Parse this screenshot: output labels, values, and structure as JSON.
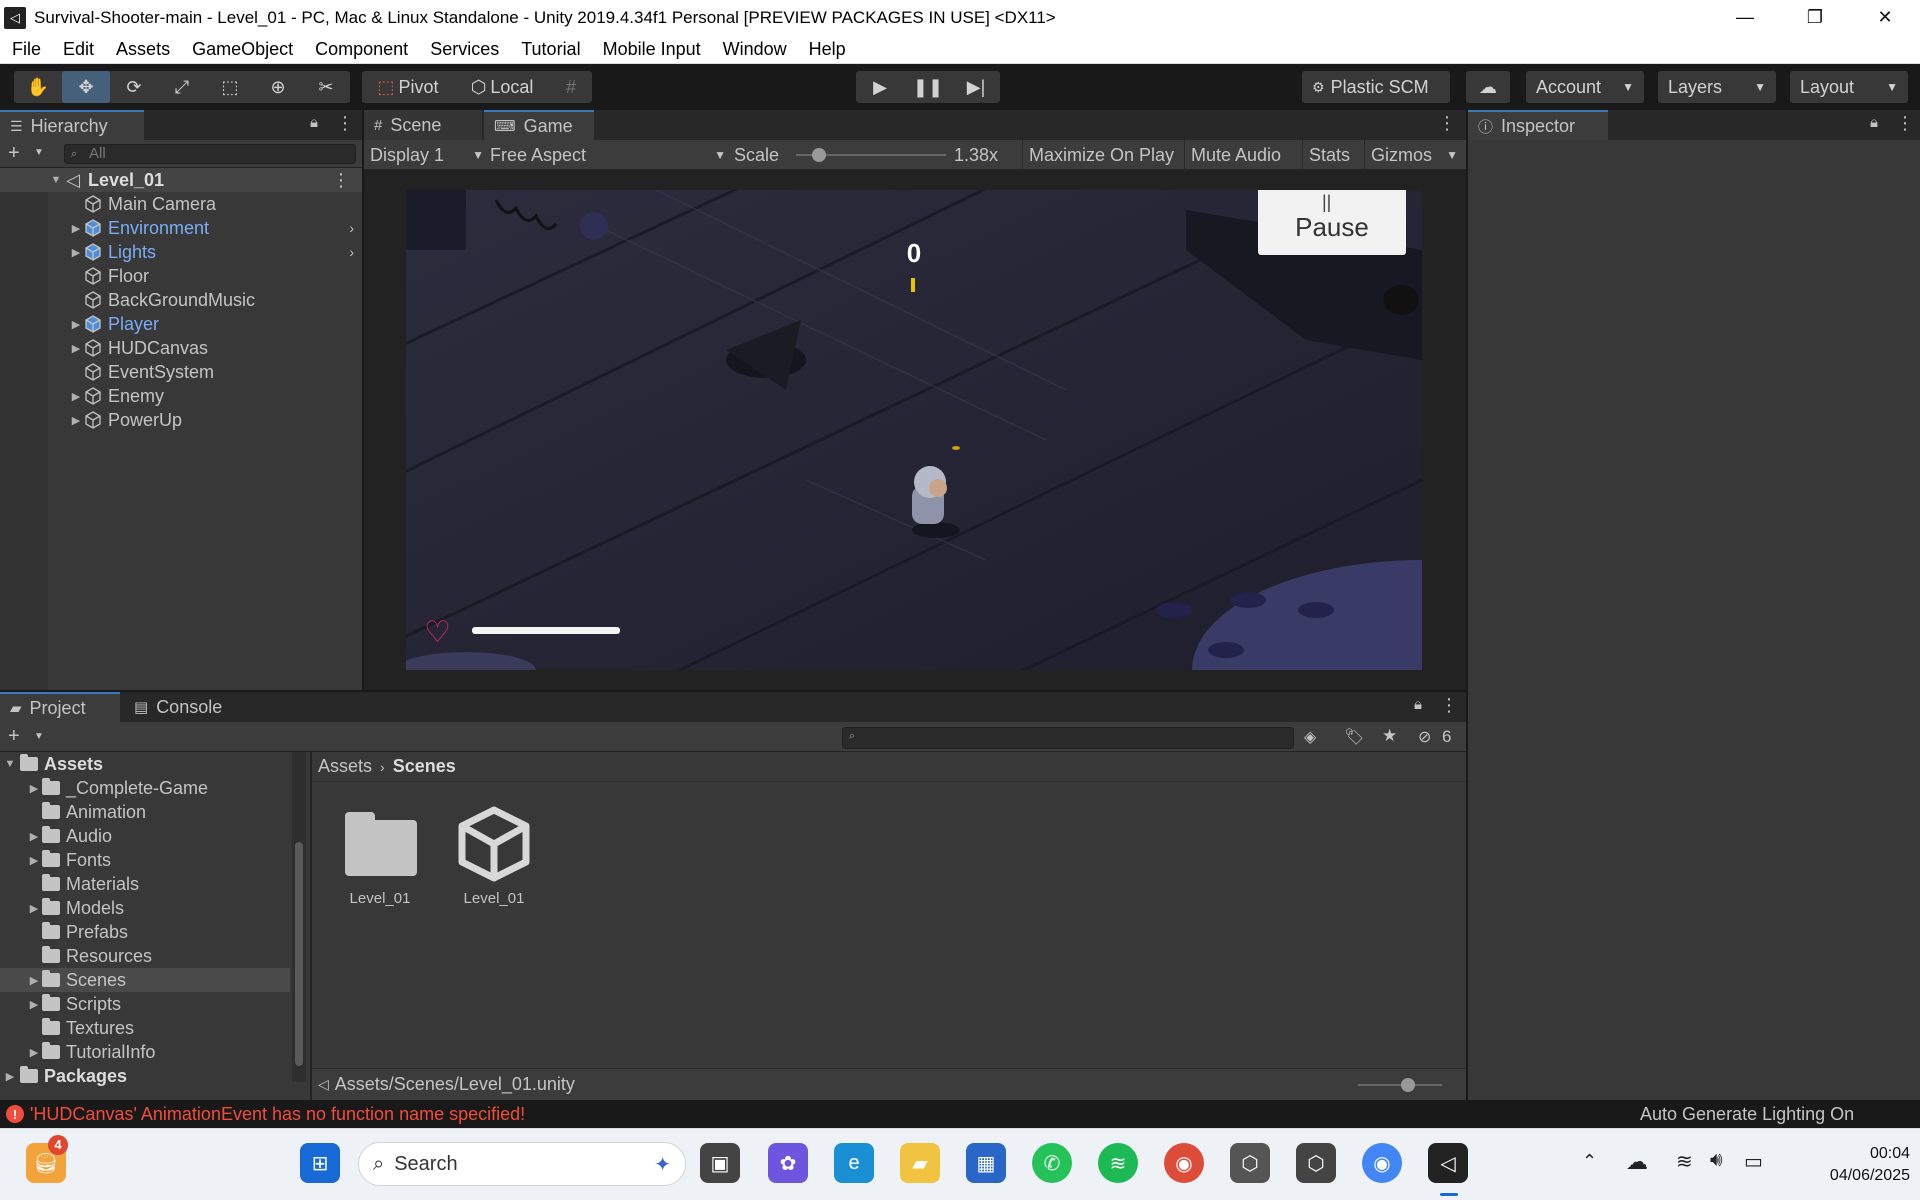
{
  "window": {
    "title": "Survival-Shooter-main - Level_01 - PC, Mac & Linux Standalone - Unity 2019.4.34f1 Personal [PREVIEW PACKAGES IN USE] <DX11>"
  },
  "menu": [
    "File",
    "Edit",
    "Assets",
    "GameObject",
    "Component",
    "Services",
    "Tutorial",
    "Mobile Input",
    "Window",
    "Help"
  ],
  "toolbar": {
    "pivot_label": "Pivot",
    "local_label": "Local",
    "plastic_label": "Plastic SCM",
    "account_label": "Account",
    "layers_label": "Layers",
    "layout_label": "Layout"
  },
  "hierarchy": {
    "tab_label": "Hierarchy",
    "search_placeholder": "All",
    "scene_name": "Level_01",
    "items": [
      {
        "label": "Main Camera",
        "prefab": false,
        "expandable": false
      },
      {
        "label": "Environment",
        "prefab": true,
        "expandable": true
      },
      {
        "label": "Lights",
        "prefab": true,
        "expandable": true
      },
      {
        "label": "Floor",
        "prefab": false,
        "expandable": false
      },
      {
        "label": "BackGroundMusic",
        "prefab": false,
        "expandable": false
      },
      {
        "label": "Player",
        "prefab": true,
        "expandable": true
      },
      {
        "label": "HUDCanvas",
        "prefab": false,
        "expandable": true
      },
      {
        "label": "EventSystem",
        "prefab": false,
        "expandable": false
      },
      {
        "label": "Enemy",
        "prefab": false,
        "expandable": true
      },
      {
        "label": "PowerUp",
        "prefab": false,
        "expandable": true
      }
    ]
  },
  "game": {
    "scene_tab": "Scene",
    "game_tab": "Game",
    "display": "Display 1",
    "aspect": "Free Aspect",
    "scale_label": "Scale",
    "scale_value": "1.38x",
    "scale_fraction": 0.15,
    "maximize": "Maximize On Play",
    "mute": "Mute Audio",
    "stats": "Stats",
    "gizmos": "Gizmos",
    "hud_score": "0",
    "pause_label": "Pause",
    "health_fraction": 1.0
  },
  "inspector": {
    "tab_label": "Inspector"
  },
  "project": {
    "project_tab": "Project",
    "console_tab": "Console",
    "hidden_count": "6",
    "breadcrumb_root": "Assets",
    "breadcrumb_current": "Scenes",
    "tree_root": "Assets",
    "tree": [
      {
        "label": "_Complete-Game",
        "expandable": true,
        "selected": false
      },
      {
        "label": "Animation",
        "expandable": false,
        "selected": false
      },
      {
        "label": "Audio",
        "expandable": true,
        "selected": false
      },
      {
        "label": "Fonts",
        "expandable": true,
        "selected": false
      },
      {
        "label": "Materials",
        "expandable": false,
        "selected": false
      },
      {
        "label": "Models",
        "expandable": true,
        "selected": false
      },
      {
        "label": "Prefabs",
        "expandable": false,
        "selected": false
      },
      {
        "label": "Resources",
        "expandable": false,
        "selected": false
      },
      {
        "label": "Scenes",
        "expandable": true,
        "selected": true
      },
      {
        "label": "Scripts",
        "expandable": true,
        "selected": false
      },
      {
        "label": "Textures",
        "expandable": false,
        "selected": false
      },
      {
        "label": "TutorialInfo",
        "expandable": true,
        "selected": false
      }
    ],
    "packages_label": "Packages",
    "assets": [
      {
        "label": "Level_01",
        "kind": "folder"
      },
      {
        "label": "Level_01",
        "kind": "scene"
      }
    ],
    "status_path": "Assets/Scenes/Level_01.unity"
  },
  "status": {
    "error": "'HUDCanvas' AnimationEvent has no function name specified!",
    "right": "Auto Generate Lighting On"
  },
  "taskbar": {
    "badge": "4",
    "search": "Search",
    "time": "00:04",
    "date": "04/06/2025"
  },
  "colors": {
    "prefab_blue": "#7bacf5",
    "selection": "#2c5d87",
    "error_red": "#f14c3c",
    "accent": "#3a79bb"
  }
}
